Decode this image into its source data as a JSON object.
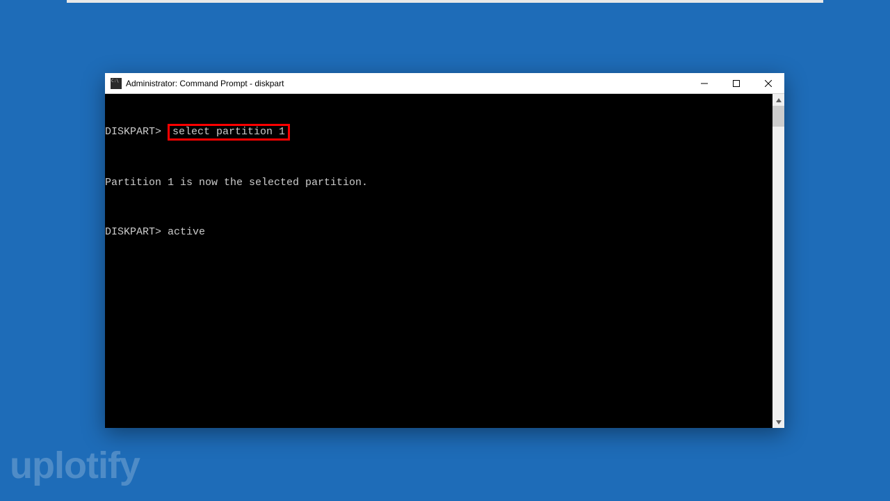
{
  "window": {
    "title": "Administrator: Command Prompt - diskpart"
  },
  "console": {
    "lines": [
      {
        "prompt": "DISKPART>",
        "command": "select partition 1",
        "highlighted": true
      },
      {
        "text": "Partition 1 is now the selected partition."
      },
      {
        "prompt": "DISKPART>",
        "command": "active",
        "highlighted": false
      }
    ]
  },
  "watermark": "uplotify"
}
